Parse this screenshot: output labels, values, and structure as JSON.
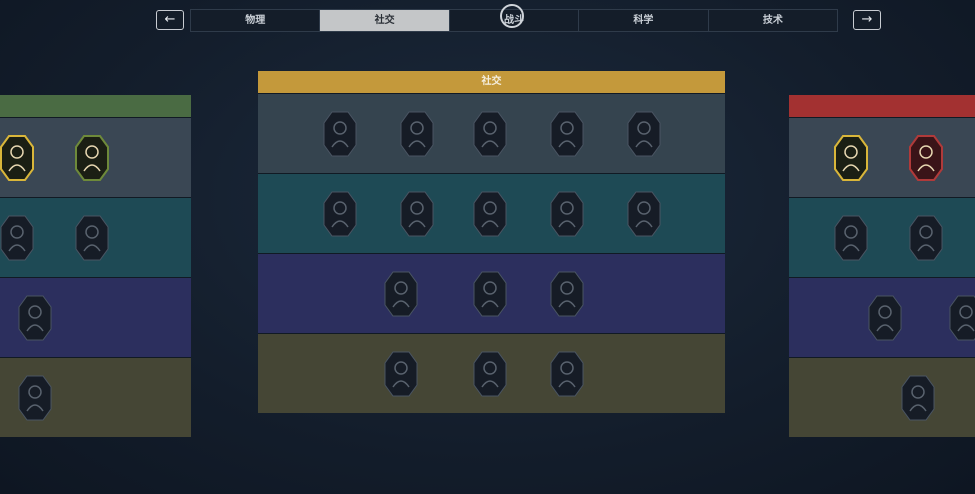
{
  "nav": {
    "prev_label": "←",
    "next_label": "→",
    "tabs": [
      {
        "label": "物理",
        "active": false
      },
      {
        "label": "社交",
        "active": true
      },
      {
        "label": "战斗",
        "active": false
      },
      {
        "label": "科学",
        "active": false
      },
      {
        "label": "技术",
        "active": false
      }
    ]
  },
  "center_panel": {
    "title": "社交",
    "header_color": "#c4993b",
    "row_colors": [
      "#35444f",
      "#1e4a55",
      "#2c2f5e",
      "#454635"
    ],
    "rows": [
      [
        {
          "icon": "pointing-hand-icon"
        },
        {
          "icon": "handshake-icon"
        },
        {
          "icon": "two-heads-icon"
        },
        {
          "icon": "brain-hand-icon"
        },
        {
          "icon": "face-profile-icon"
        }
      ],
      [
        {
          "icon": "mask-figure-icon"
        },
        {
          "icon": "shake-hands-icon"
        },
        {
          "icon": "gorilla-icon"
        },
        {
          "icon": "leader-figure-icon"
        },
        {
          "icon": "offering-hand-icon"
        }
      ],
      [
        {
          "icon": "group-figures-icon"
        },
        {
          "icon": "soldier-figure-icon"
        },
        {
          "icon": "coins-icon"
        }
      ],
      [
        {
          "icon": "puppet-icon"
        },
        {
          "icon": "raised-arms-icon"
        },
        {
          "icon": "globe-hand-icon"
        }
      ]
    ]
  },
  "left_panel": {
    "header_color": "#4a6b43",
    "row_colors": [
      "#3a4754",
      "#1e4a55",
      "#2c2f5e",
      "#454635"
    ],
    "rows": [
      [
        {
          "icon": "winged-skull-icon",
          "unlocked": true,
          "border": "#d9b63a"
        },
        {
          "icon": "anatomical-heart-icon",
          "unlocked": true,
          "border": "#6e8a3a"
        }
      ],
      [
        {
          "icon": "campfire-icon"
        },
        {
          "icon": "gear-eye-icon"
        }
      ],
      [
        {
          "icon": "fist-icon"
        }
      ],
      [
        {
          "icon": "lotus-icon"
        }
      ]
    ]
  },
  "right_panel": {
    "header_color": "#a33131",
    "row_colors": [
      "#3a4754",
      "#1e4a55",
      "#2c2f5e",
      "#454635"
    ],
    "rows": [
      [
        {
          "icon": "rifle-icon",
          "unlocked": true,
          "border": "#d9b63a"
        },
        {
          "icon": "combat-knife-icon",
          "unlocked": true,
          "border": "#b03a3a"
        }
      ],
      [
        {
          "icon": "grenade-icon"
        },
        {
          "icon": "blade-icon"
        }
      ],
      [
        {
          "icon": "sniper-icon"
        },
        {
          "icon": "shield-partial-icon"
        }
      ],
      [
        {
          "icon": "armored-beast-icon"
        }
      ]
    ]
  }
}
